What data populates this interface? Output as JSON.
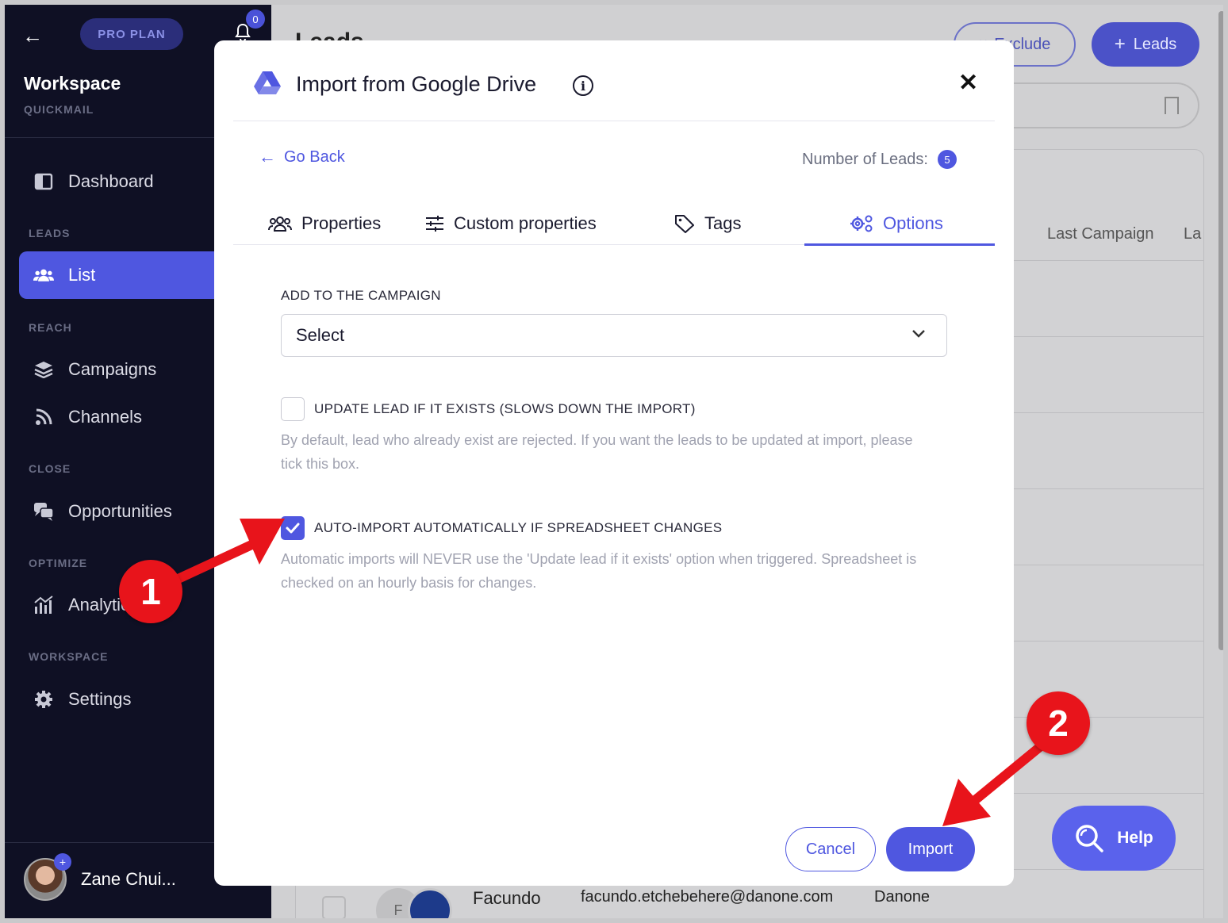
{
  "sidebar": {
    "pro_plan": "PRO PLAN",
    "bell_count": "0",
    "workspace_title": "Workspace",
    "workspace_sub": "QUICKMAIL",
    "sections": {
      "leads": "LEADS",
      "reach": "REACH",
      "close": "CLOSE",
      "optimize": "OPTIMIZE",
      "workspace": "WORKSPACE"
    },
    "items": {
      "dashboard": "Dashboard",
      "list": "List",
      "campaigns": "Campaigns",
      "channels": "Channels",
      "opportunities": "Opportunities",
      "analytics": "Analytics",
      "settings": "Settings"
    },
    "user_name": "Zane Chui..."
  },
  "main": {
    "title": "Leads",
    "exclude_label": "Exclude",
    "leads_button_label": "Leads",
    "columns": {
      "last_campaign": "Last Campaign",
      "last_partial": "La"
    },
    "bottom_row": {
      "first_name": "Facundo",
      "avatar_initial": "F",
      "email": "facundo.etchebehere@danone.com",
      "company": "Danone"
    }
  },
  "modal": {
    "title": "Import from Google Drive",
    "go_back": "Go Back",
    "number_of_leads_label": "Number of Leads:",
    "number_of_leads": "5",
    "tabs": [
      {
        "label": "Properties",
        "active": false
      },
      {
        "label": "Custom properties",
        "active": false
      },
      {
        "label": "Tags",
        "active": false
      },
      {
        "label": "Options",
        "active": true
      }
    ],
    "campaign_label": "ADD TO THE CAMPAIGN",
    "campaign_select": "Select",
    "update_lead": {
      "label": "UPDATE LEAD IF IT EXISTS (SLOWS DOWN THE IMPORT)",
      "checked": false,
      "help": "By default, lead who already exist are rejected. If you want the leads to be updated at import, please tick this box."
    },
    "auto_import": {
      "label": "AUTO-IMPORT AUTOMATICALLY IF SPREADSHEET CHANGES",
      "checked": true,
      "help": "Automatic imports will NEVER use the 'Update lead if it exists' option when triggered. Spreadsheet is checked on an hourly basis for changes."
    },
    "cancel_label": "Cancel",
    "import_label": "Import"
  },
  "help_label": "Help",
  "annotations": {
    "step1": "1",
    "step2": "2"
  },
  "colors": {
    "accent": "#4f57e0",
    "sidebar_bg": "#0f1024",
    "annotation_red": "#e8141b"
  }
}
